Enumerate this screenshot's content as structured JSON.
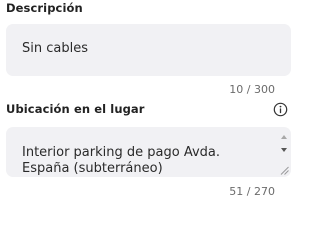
{
  "description": {
    "label": "Descripción",
    "value": "Sin cables",
    "counter": "10 / 300"
  },
  "location": {
    "label": "Ubicación en el lugar",
    "value": "Interior parking de pago Avda. España (subterráneo)",
    "counter": "51 / 270",
    "info_icon": "info-circle-icon"
  }
}
